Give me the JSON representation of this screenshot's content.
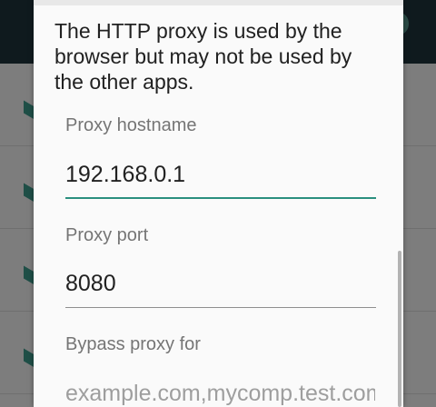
{
  "dialog": {
    "message": "The HTTP proxy is used by the browser but may not be used by the other apps.",
    "fields": [
      {
        "label": "Proxy hostname",
        "value": "192.168.0.1",
        "placeholder": ""
      },
      {
        "label": "Proxy port",
        "value": "8080",
        "placeholder": ""
      },
      {
        "label": "Bypass proxy for",
        "value": "",
        "placeholder": "example.com,mycomp.test.com,localhost"
      }
    ]
  },
  "colors": {
    "accent": "#2a8f7e",
    "dialog_background": "#fafafa",
    "scrim_toolbar": "#0f1a1e"
  }
}
